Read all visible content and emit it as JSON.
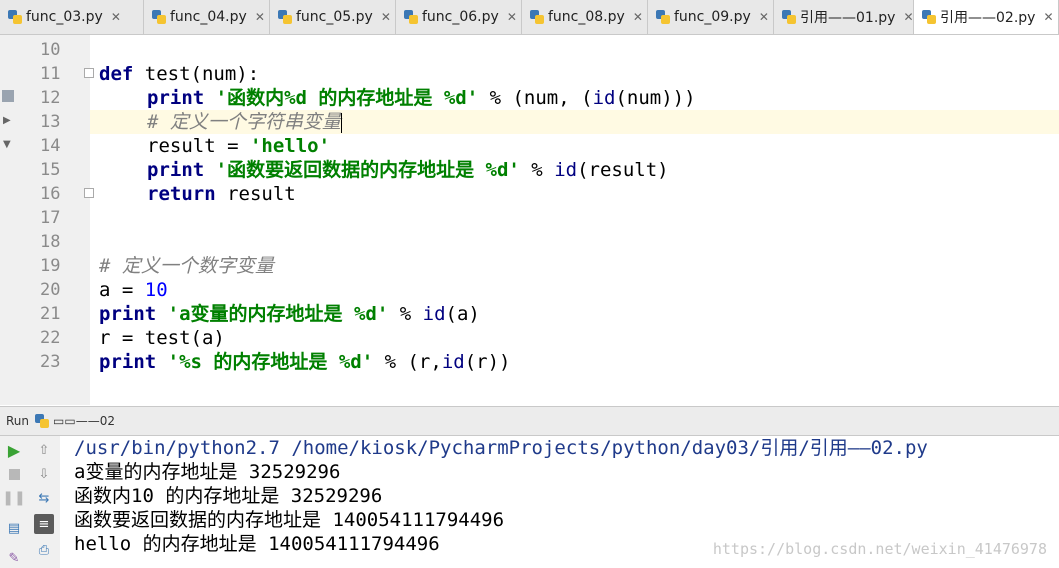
{
  "tabs": [
    {
      "label": "func_03.py"
    },
    {
      "label": "func_04.py"
    },
    {
      "label": "func_05.py"
    },
    {
      "label": "func_06.py"
    },
    {
      "label": "func_08.py"
    },
    {
      "label": "func_09.py"
    },
    {
      "label": "引用——01.py"
    },
    {
      "label": "引用——02.py",
      "active": true
    }
  ],
  "editor": {
    "line_numbers": [
      "10",
      "11",
      "12",
      "13",
      "14",
      "15",
      "16",
      "17",
      "18",
      "19",
      "20",
      "21",
      "22",
      "23"
    ],
    "current_line": "13",
    "code": {
      "l11_def": "def",
      "l11_rest": " test(num):",
      "l12_print": "print",
      "l12_str": "'函数内%d 的内存地址是 %d'",
      "l12_mid": " % (num, (",
      "l12_id": "id",
      "l12_end": "(num)))",
      "l13_comment": "# 定义一个字符串变量",
      "l14_pre": "result = ",
      "l14_str": "'hello'",
      "l15_print": "print",
      "l15_str": "'函数要返回数据的内存地址是 %d'",
      "l15_mid": " % ",
      "l15_id": "id",
      "l15_end": "(result)",
      "l16_return": "return",
      "l16_rest": " result",
      "l19_comment": "# 定义一个数字变量",
      "l20_pre": "a = ",
      "l20_num": "10",
      "l21_print": "print",
      "l21_str": "'a变量的内存地址是 %d'",
      "l21_mid": " % ",
      "l21_id": "id",
      "l21_end": "(a)",
      "l22": "r = test(a)",
      "l23_print": "print",
      "l23_str": "'%s 的内存地址是 %d'",
      "l23_mid": " % (r,",
      "l23_id": "id",
      "l23_end": "(r))"
    }
  },
  "run": {
    "label": "Run",
    "config": "▭▭——02"
  },
  "console": {
    "lines": [
      "/usr/bin/python2.7 /home/kiosk/PycharmProjects/python/day03/引用/引用——02.py",
      "a变量的内存地址是 32529296",
      "函数内10 的内存地址是 32529296",
      "函数要返回数据的内存地址是 140054111794496",
      "hello 的内存地址是 140054111794496"
    ],
    "watermark": "https://blog.csdn.net/weixin_41476978"
  },
  "colors": {
    "keyword": "#000080",
    "string": "#008000",
    "number": "#0000ff",
    "comment": "#808080",
    "current_line": "#fffae3"
  }
}
